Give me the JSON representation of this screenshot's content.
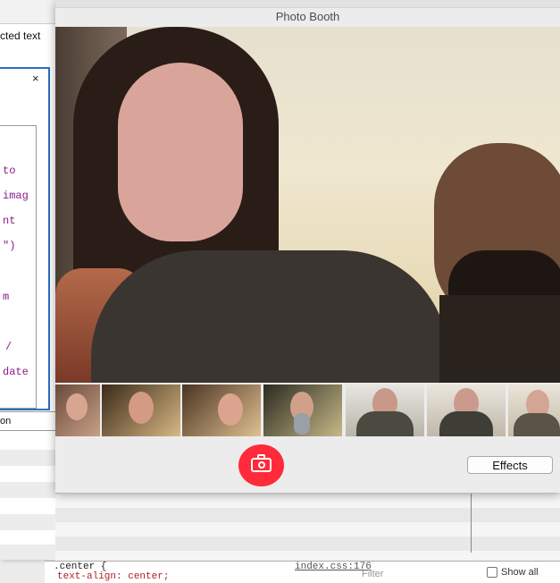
{
  "background_editor": {
    "selected_text_label": "cted text",
    "panel_close": "×",
    "code_lines": [
      "to",
      "imag",
      "nt",
      "\")",
      "m",
      "/",
      "date"
    ],
    "field_text": "on"
  },
  "lower_panel": {
    "filter_placeholder": "Filter",
    "show_all_label": "Show all",
    "css_selector": ".center {",
    "css_property": "text-align: center;",
    "source_link": "index.css:176"
  },
  "photo_booth": {
    "window_title": "Photo Booth",
    "filmstrip_count": 7,
    "take_photo_icon": "camera-icon",
    "effects_label": "Effects"
  },
  "colors": {
    "shutter_red": "#ff2a3a",
    "selection_blue": "#2a6fbe",
    "code_purple": "#8a1a8a"
  }
}
